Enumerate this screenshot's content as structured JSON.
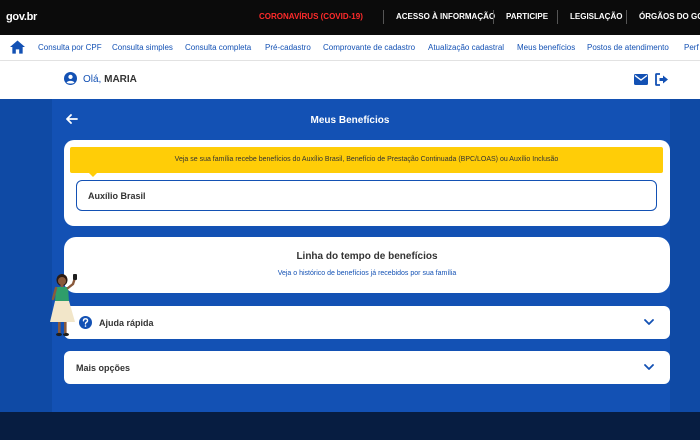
{
  "govbar": {
    "logo": "gov.br",
    "links": [
      {
        "label": "CORONAVÍRUS (COVID-19)",
        "highlight": true
      },
      {
        "label": "ACESSO À INFORMAÇÃO"
      },
      {
        "label": "PARTICIPE"
      },
      {
        "label": "LEGISLAÇÃO"
      },
      {
        "label": "ÓRGÃOS DO GOVE"
      }
    ],
    "highlight_color": "#ff2b2b"
  },
  "nav": {
    "home_icon": "home-icon",
    "items": [
      "Consulta por CPF",
      "Consulta simples",
      "Consulta completa",
      "Pré-cadastro",
      "Comprovante de cadastro",
      "Atualização cadastral",
      "Meus benefícios",
      "Postos de atendimento",
      "Perf"
    ]
  },
  "user": {
    "greeting": "Olá,",
    "name": "MARIA",
    "icons": [
      "user-icon",
      "mail-icon",
      "exit-icon"
    ]
  },
  "main": {
    "title": "Meus Benefícios",
    "notice": "Veja se sua família recebe benefícios do Auxílio Brasil, Benefício de Prestação Continuada (BPC/LOAS) ou Auxílio Inclusão",
    "selected_benefit": "Auxílio Brasil",
    "timeline": {
      "title": "Linha do tempo de benefícios",
      "subtitle": "Veja o histórico de benefícios já recebidos por sua família"
    },
    "accordions": [
      {
        "label": "Ajuda rápida",
        "icon": "question-icon"
      },
      {
        "label": "Mais opções"
      }
    ]
  },
  "colors": {
    "primary_blue": "#1351b4",
    "notice_yellow": "#ffcd07",
    "dark_footer": "#071d41"
  }
}
